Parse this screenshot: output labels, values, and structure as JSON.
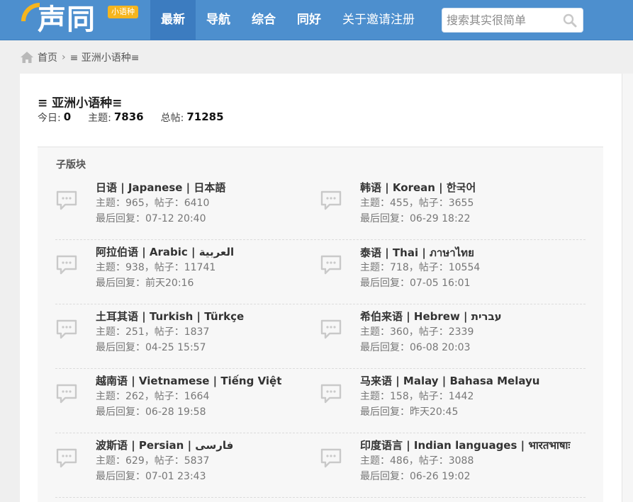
{
  "header": {
    "logo_text": "声同",
    "logo_badge": "小语种",
    "nav": [
      {
        "label": "最新",
        "active": true
      },
      {
        "label": "导航",
        "active": false
      },
      {
        "label": "综合",
        "active": false
      },
      {
        "label": "同好",
        "active": false
      },
      {
        "label": "关于邀请注册",
        "active": false
      }
    ],
    "search_placeholder": "搜索其实很简单"
  },
  "breadcrumb": {
    "home": "首页",
    "separator": "›",
    "current": "≡ 亚洲小语种≡"
  },
  "forum": {
    "title": "≡ 亚洲小语种≡",
    "today_label": "今日:",
    "today_value": "0",
    "topics_label": "主题:",
    "topics_value": "7836",
    "posts_label": "总帖:",
    "posts_value": "71285"
  },
  "subforums": {
    "title": "子版块",
    "items": [
      {
        "name": "日语 | Japanese | 日本語",
        "stat": "主题：965，帖子：6410",
        "last": "最后回复：07-12 20:40"
      },
      {
        "name": "韩语 | Korean | 한국어",
        "stat": "主题：455，帖子：3655",
        "last": "最后回复：06-29 18:22"
      },
      {
        "name": "阿拉伯语 | Arabic | العربية",
        "stat": "主题：938，帖子：11741",
        "last": "最后回复：前天20:16"
      },
      {
        "name": "泰语 | Thai | ภาษาไทย",
        "stat": "主题：718，帖子：10554",
        "last": "最后回复：07-05 16:01"
      },
      {
        "name": "土耳其语 | Turkish | Türkçe",
        "stat": "主题：251，帖子：1837",
        "last": "最后回复：04-25 15:57"
      },
      {
        "name": "希伯来语 | Hebrew | עברית",
        "stat": "主题：360，帖子：2339",
        "last": "最后回复：06-08 20:03"
      },
      {
        "name": "越南语 | Vietnamese | Tiếng Việt",
        "stat": "主题：262，帖子：1664",
        "last": "最后回复：06-28 19:58"
      },
      {
        "name": "马来语 | Malay | Bahasa Melayu",
        "stat": "主题：158，帖子：1442",
        "last": "最后回复：昨天20:45"
      },
      {
        "name": "波斯语 | Persian | فارسی",
        "stat": "主题：629，帖子：5837",
        "last": "最后回复：07-01 23:43"
      },
      {
        "name": "印度语言 | Indian languages | भारतभाषाः",
        "stat": "主题：486，帖子：3088",
        "last": "最后回复：06-26 19:02"
      }
    ]
  },
  "colors": {
    "header_bg": "#4d8fce",
    "nav_active_bg": "#3c7cc0",
    "logo_accent": "#f5b51e"
  }
}
